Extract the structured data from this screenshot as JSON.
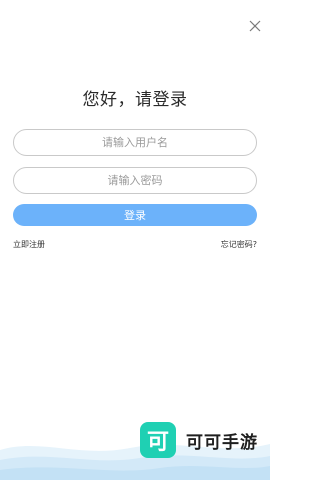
{
  "icons": {
    "close": "close-icon",
    "logo": "keke-logo-icon"
  },
  "header": {
    "title": "您好，请登录"
  },
  "form": {
    "username_placeholder": "请输入用户名",
    "password_placeholder": "请输入密码",
    "login_label": "登录"
  },
  "links": {
    "register": "立即注册",
    "forgot": "忘记密码?"
  },
  "brand": {
    "logo_char": "可",
    "name": "可可手游"
  },
  "colors": {
    "accent": "#6cb2fa",
    "logo": "#1fd0b3",
    "wave": "#d8ecf9"
  }
}
